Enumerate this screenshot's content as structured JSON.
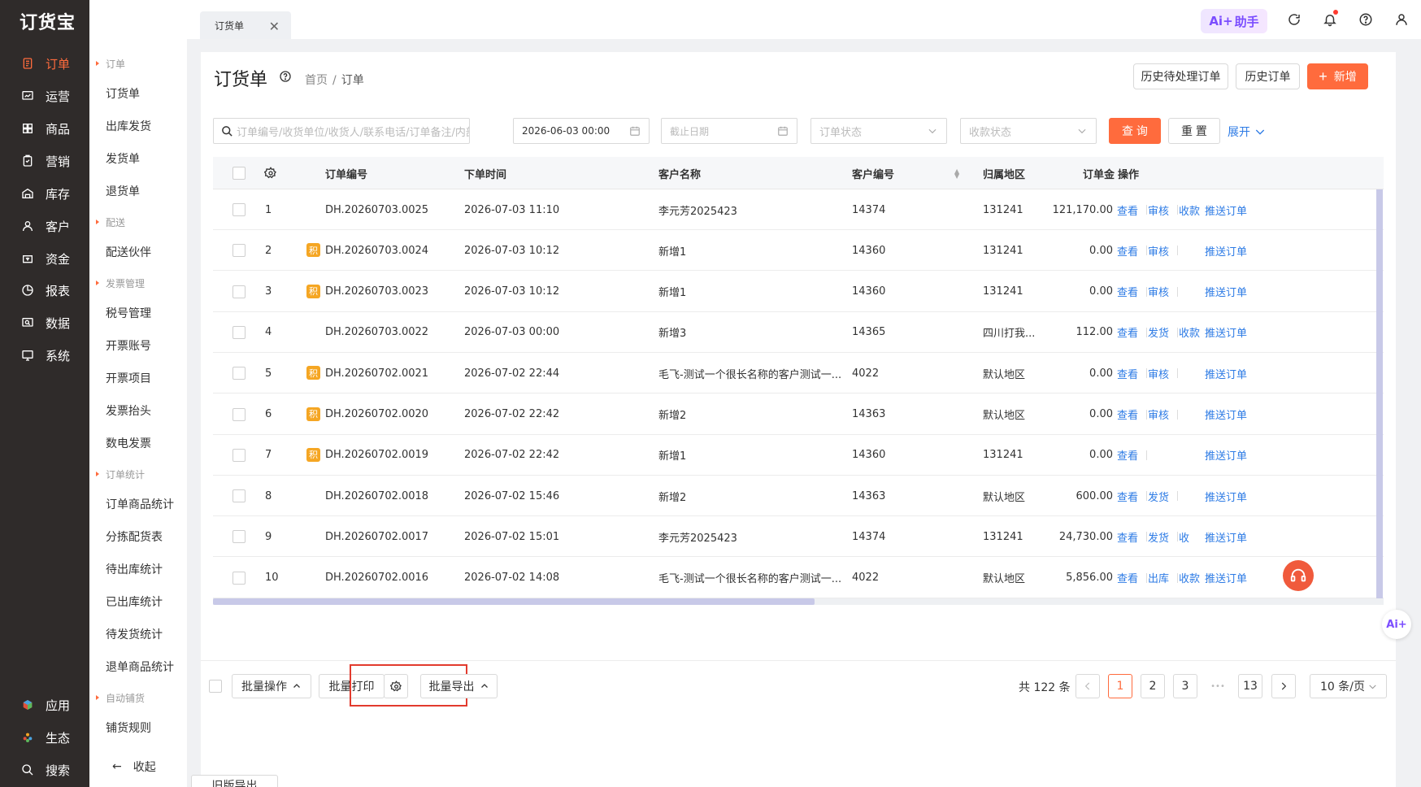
{
  "brand": {
    "logo": "订货宝"
  },
  "leftnav": {
    "items": [
      {
        "label": "订单",
        "icon": "order-icon",
        "active": true
      },
      {
        "label": "运营",
        "icon": "operation-icon"
      },
      {
        "label": "商品",
        "icon": "goods-icon"
      },
      {
        "label": "营销",
        "icon": "marketing-icon"
      },
      {
        "label": "库存",
        "icon": "warehouse-icon"
      },
      {
        "label": "客户",
        "icon": "customer-icon"
      },
      {
        "label": "资金",
        "icon": "funds-icon"
      },
      {
        "label": "报表",
        "icon": "report-icon"
      },
      {
        "label": "数据",
        "icon": "data-icon"
      },
      {
        "label": "系统",
        "icon": "system-icon"
      }
    ],
    "bottom": [
      {
        "label": "应用",
        "icon": "apps-icon"
      },
      {
        "label": "生态",
        "icon": "ecosystem-icon"
      },
      {
        "label": "搜索",
        "icon": "search-icon"
      }
    ]
  },
  "submenu": {
    "groups": [
      {
        "title": "订单",
        "items": [
          "订货单",
          "出库发货",
          "发货单",
          "退货单"
        ]
      },
      {
        "title": "配送",
        "items": [
          "配送伙伴"
        ]
      },
      {
        "title": "发票管理",
        "items": [
          "税号管理",
          "开票账号",
          "开票项目",
          "发票抬头",
          "数电发票"
        ]
      },
      {
        "title": "订单统计",
        "items": [
          "订单商品统计",
          "分拣配货表",
          "待出库统计",
          "已出库统计",
          "待发货统计",
          "退单商品统计"
        ]
      },
      {
        "title": "自动铺货",
        "items": [
          "铺货规则"
        ]
      }
    ],
    "collapse": "收起"
  },
  "topbar": {
    "tab": "订货单",
    "ai_label": "助手",
    "ai_prefix": "Ai+"
  },
  "header": {
    "title": "订货单",
    "breadcrumb": [
      "首页",
      "订单"
    ],
    "buttons": {
      "history_pending": "历史待处理订单",
      "history": "历史订单",
      "add": "新增"
    }
  },
  "filters": {
    "search_placeholder": "订单编号/收货单位/收货人/联系电话/订单备注/内部",
    "start_date": "2026-06-03 00:00",
    "end_date_placeholder": "截止日期",
    "order_status_placeholder": "订单状态",
    "payment_status_placeholder": "收款状态",
    "query": "查 询",
    "reset": "重 置",
    "expand": "展开"
  },
  "table": {
    "columns": [
      "订单编号",
      "下单时间",
      "客户名称",
      "客户编号",
      "归属地区",
      "订单金",
      "操作"
    ],
    "badge": "积",
    "rows": [
      {
        "no": "1",
        "badge": false,
        "order": "DH.20260703.0025",
        "time": "2026-07-03 11:10",
        "customer": "李元芳2025423",
        "cid": "14374",
        "region": "131241",
        "amount": "121,170.00",
        "ops": [
          "查看",
          "审核",
          "收款",
          "推送订单"
        ]
      },
      {
        "no": "2",
        "badge": true,
        "order": "DH.20260703.0024",
        "time": "2026-07-03 10:12",
        "customer": "新增1",
        "cid": "14360",
        "region": "131241",
        "amount": "0.00",
        "ops": [
          "查看",
          "审核",
          "",
          "推送订单"
        ]
      },
      {
        "no": "3",
        "badge": true,
        "order": "DH.20260703.0023",
        "time": "2026-07-03 10:12",
        "customer": "新增1",
        "cid": "14360",
        "region": "131241",
        "amount": "0.00",
        "ops": [
          "查看",
          "审核",
          "",
          "推送订单"
        ]
      },
      {
        "no": "4",
        "badge": false,
        "order": "DH.20260703.0022",
        "time": "2026-07-03 00:00",
        "customer": "新增3",
        "cid": "14365",
        "region": "四川打我...",
        "amount": "112.00",
        "ops": [
          "查看",
          "发货",
          "收款",
          "推送订单"
        ]
      },
      {
        "no": "5",
        "badge": true,
        "order": "DH.20260702.0021",
        "time": "2026-07-02 22:44",
        "customer": "毛飞-测试一个很长名称的客户测试一...",
        "cid": "4022",
        "region": "默认地区",
        "amount": "0.00",
        "ops": [
          "查看",
          "审核",
          "",
          "推送订单"
        ]
      },
      {
        "no": "6",
        "badge": true,
        "order": "DH.20260702.0020",
        "time": "2026-07-02 22:42",
        "customer": "新增2",
        "cid": "14363",
        "region": "默认地区",
        "amount": "0.00",
        "ops": [
          "查看",
          "审核",
          "",
          "推送订单"
        ]
      },
      {
        "no": "7",
        "badge": true,
        "order": "DH.20260702.0019",
        "time": "2026-07-02 22:42",
        "customer": "新增1",
        "cid": "14360",
        "region": "131241",
        "amount": "0.00",
        "ops": [
          "查看",
          "",
          "",
          "推送订单"
        ]
      },
      {
        "no": "8",
        "badge": false,
        "order": "DH.20260702.0018",
        "time": "2026-07-02 15:46",
        "customer": "新增2",
        "cid": "14363",
        "region": "默认地区",
        "amount": "600.00",
        "ops": [
          "查看",
          "发货",
          "",
          "推送订单"
        ]
      },
      {
        "no": "9",
        "badge": false,
        "order": "DH.20260702.0017",
        "time": "2026-07-02 15:01",
        "customer": "李元芳2025423",
        "cid": "14374",
        "region": "131241",
        "amount": "24,730.00",
        "ops": [
          "查看",
          "发货",
          "收",
          "推送订单"
        ]
      },
      {
        "no": "10",
        "badge": false,
        "order": "DH.20260702.0016",
        "time": "2026-07-02 14:08",
        "customer": "毛飞-测试一个很长名称的客户测试一...",
        "cid": "4022",
        "region": "默认地区",
        "amount": "5,856.00",
        "ops": [
          "查看",
          "出库",
          "收款",
          "推送订单"
        ]
      }
    ]
  },
  "footer": {
    "batch_ops": "批量操作",
    "batch_print": "批量打印",
    "batch_export": "批量导出",
    "old_export": "旧版导出",
    "total": "共 122 条",
    "pages": [
      "1",
      "2",
      "3",
      "•••",
      "13"
    ],
    "page_size": "10 条/页"
  },
  "float": {
    "ai": "Ai+"
  },
  "colors": {
    "accent": "#ff6b3d",
    "link": "#2d7be5",
    "nav_bg": "#2f2b2a"
  }
}
